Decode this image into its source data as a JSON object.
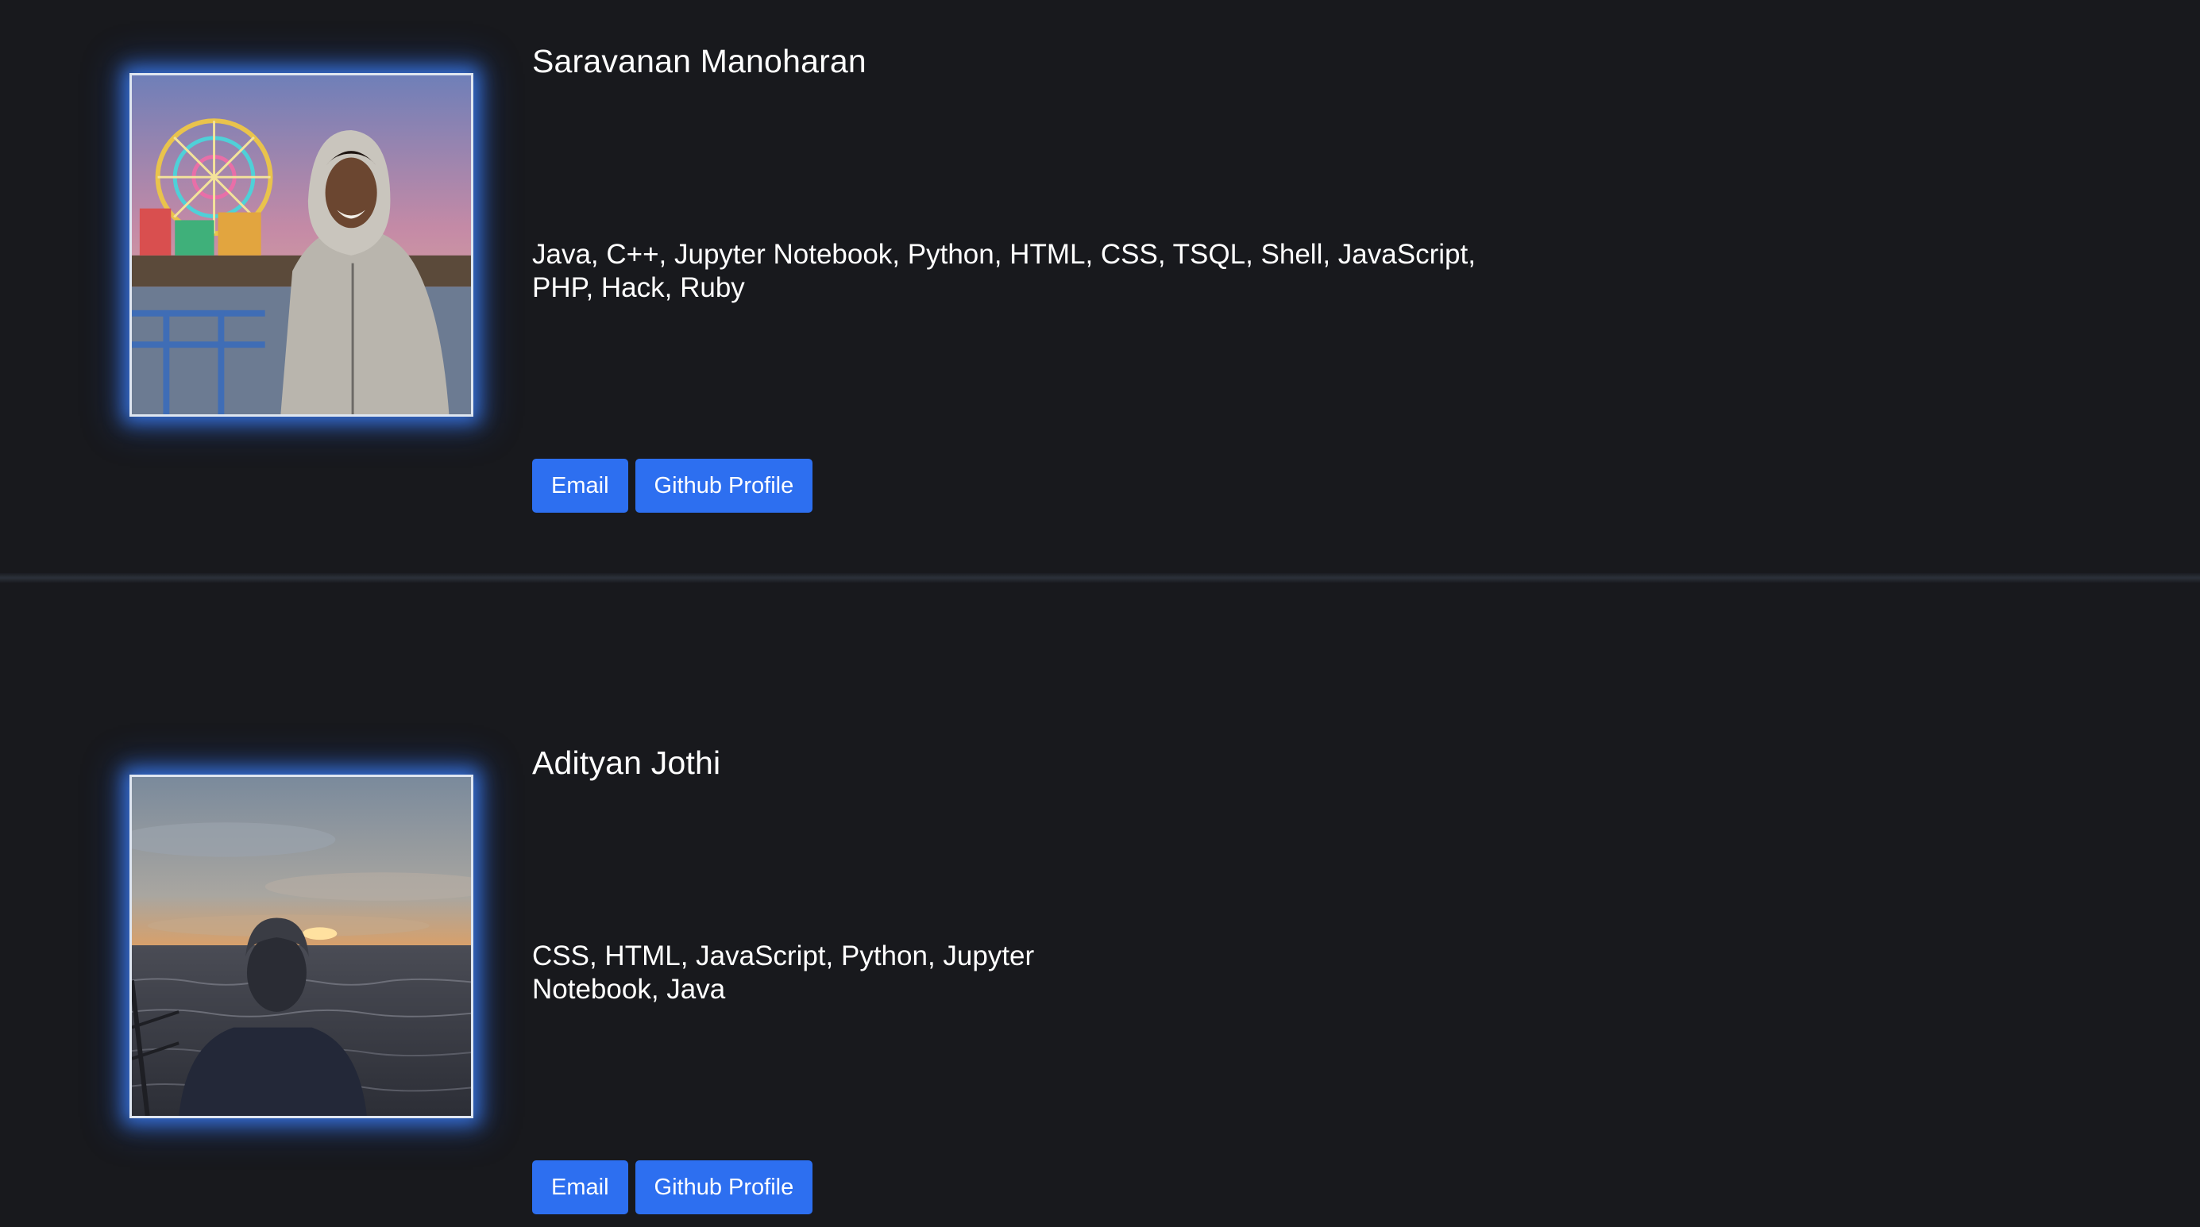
{
  "profiles": [
    {
      "name": "Saravanan Manoharan",
      "skills": "Java, C++, Jupyter Notebook, Python, HTML, CSS, TSQL, Shell, JavaScript, PHP, Hack, Ruby",
      "email_label": "Email",
      "github_label": "Github Profile"
    },
    {
      "name": "Adityan Jothi",
      "skills": "CSS, HTML, JavaScript, Python, Jupyter Notebook, Java",
      "email_label": "Email",
      "github_label": "Github Profile"
    }
  ],
  "colors": {
    "background": "#18191d",
    "button": "#2d6ff0",
    "photo_glow": "#3f84ff"
  }
}
